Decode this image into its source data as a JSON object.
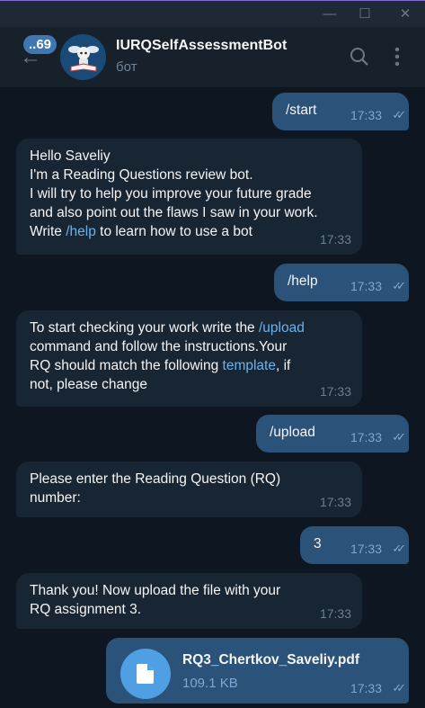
{
  "window": {
    "minimize": "—",
    "maximize": "☐",
    "close": "✕"
  },
  "header": {
    "unread_badge": "..69",
    "title": "IURQSelfAssessmentBot",
    "subtitle": "бот"
  },
  "messages": [
    {
      "dir": "out",
      "text": "/start",
      "time": "17:33"
    },
    {
      "dir": "in",
      "lines": [
        "Hello Saveliy",
        "I'm a Reading Questions review bot.",
        "I will try to help you improve your future grade",
        "and also point out the flaws I saw in your work."
      ],
      "pre": "Write ",
      "link": "/help",
      "post": " to learn how to use a bot",
      "time": "17:33"
    },
    {
      "dir": "out",
      "text": "/help",
      "time": "17:33"
    },
    {
      "dir": "in",
      "p1": "To start checking your work write the ",
      "link1": "/upload",
      "p2": "command and follow the instructions.Your RQ should match the following ",
      "link2": "template",
      "p3": ", if not, please change",
      "time": "17:33"
    },
    {
      "dir": "out",
      "text": "/upload",
      "time": "17:33"
    },
    {
      "dir": "in",
      "text": "Please enter the Reading Question (RQ) number:",
      "time": "17:33"
    },
    {
      "dir": "out",
      "text": "3",
      "time": "17:33"
    },
    {
      "dir": "in",
      "text": "Thank you! Now upload the file with your RQ assignment 3.",
      "time": "17:33"
    },
    {
      "dir": "out",
      "file_name": "RQ3_Chertkov_Saveliy.pdf",
      "file_size": "109.1 KB",
      "time": "17:33"
    }
  ]
}
